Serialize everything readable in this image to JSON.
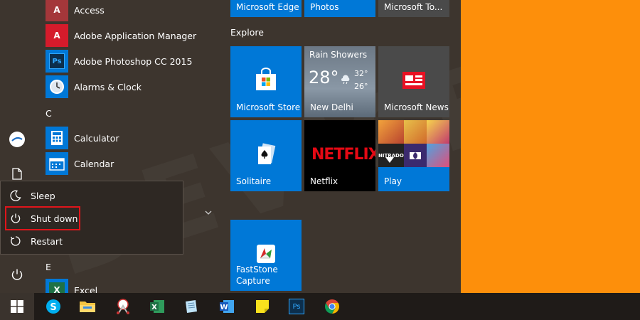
{
  "app_list": {
    "apps_a": [
      {
        "label": "Access",
        "icon": "access-icon",
        "color": "#a4373a",
        "glyph": "A"
      },
      {
        "label": "Adobe Application Manager",
        "icon": "adobe-icon",
        "color": "#d51b2b",
        "glyph": "A"
      },
      {
        "label": "Adobe Photoshop CC 2015",
        "icon": "photoshop-icon",
        "color": "#0c2f4d",
        "glyph": "Ps"
      },
      {
        "label": "Alarms & Clock",
        "icon": "alarm-clock-icon",
        "color": "#0078d7",
        "glyph": ""
      }
    ],
    "letter_c": "C",
    "apps_c": [
      {
        "label": "Calculator",
        "icon": "calculator-icon",
        "color": "#0078d7"
      },
      {
        "label": "Calendar",
        "icon": "calendar-icon",
        "color": "#0078d7"
      }
    ],
    "letter_e": "E",
    "apps_e": [
      {
        "label": "Excel",
        "icon": "excel-icon",
        "color": "#1e7145",
        "glyph": "X"
      }
    ]
  },
  "power_menu": {
    "items": [
      {
        "label": "Sleep",
        "icon": "moon-icon"
      },
      {
        "label": "Shut down",
        "icon": "power-icon"
      },
      {
        "label": "Restart",
        "icon": "restart-icon"
      }
    ]
  },
  "tiles": {
    "top_row": [
      {
        "label": "Microsoft Edge",
        "color": "#0078d7"
      },
      {
        "label": "Photos",
        "color": "#0078d7"
      },
      {
        "label": "Microsoft To...",
        "color": "#4a4a4a"
      }
    ],
    "explore_title": "Explore",
    "store": {
      "label": "Microsoft Store",
      "color": "#0078d7"
    },
    "weather": {
      "condition": "Rain Showers",
      "temp": "28°",
      "high": "32°",
      "low": "26°",
      "city": "New Delhi"
    },
    "news": {
      "label": "Microsoft News",
      "color": "#4a4a4a"
    },
    "solitaire": {
      "label": "Solitaire",
      "color": "#0078d7"
    },
    "netflix": {
      "label": "Netflix",
      "logo": "NETFLIX",
      "color": "#000000"
    },
    "play": {
      "label": "Play",
      "color": "#0078d7",
      "thumbs": [
        "NITRADO"
      ]
    },
    "faststone": {
      "label_line1": "FastStone",
      "label_line2": "Capture",
      "color": "#0078d7"
    }
  },
  "taskbar": {
    "apps": [
      "start-icon",
      "skype-icon",
      "file-explorer-icon",
      "snipping-tool-icon",
      "excel-icon",
      "notepad-icon",
      "word-icon",
      "sticky-notes-icon",
      "photoshop-icon",
      "chrome-icon"
    ],
    "photoshop_glyph": "Ps"
  },
  "colors": {
    "accent": "#0078d7",
    "highlight": "#e0151b",
    "desktop": "#fd8f0b",
    "netflix_red": "#e50914"
  }
}
